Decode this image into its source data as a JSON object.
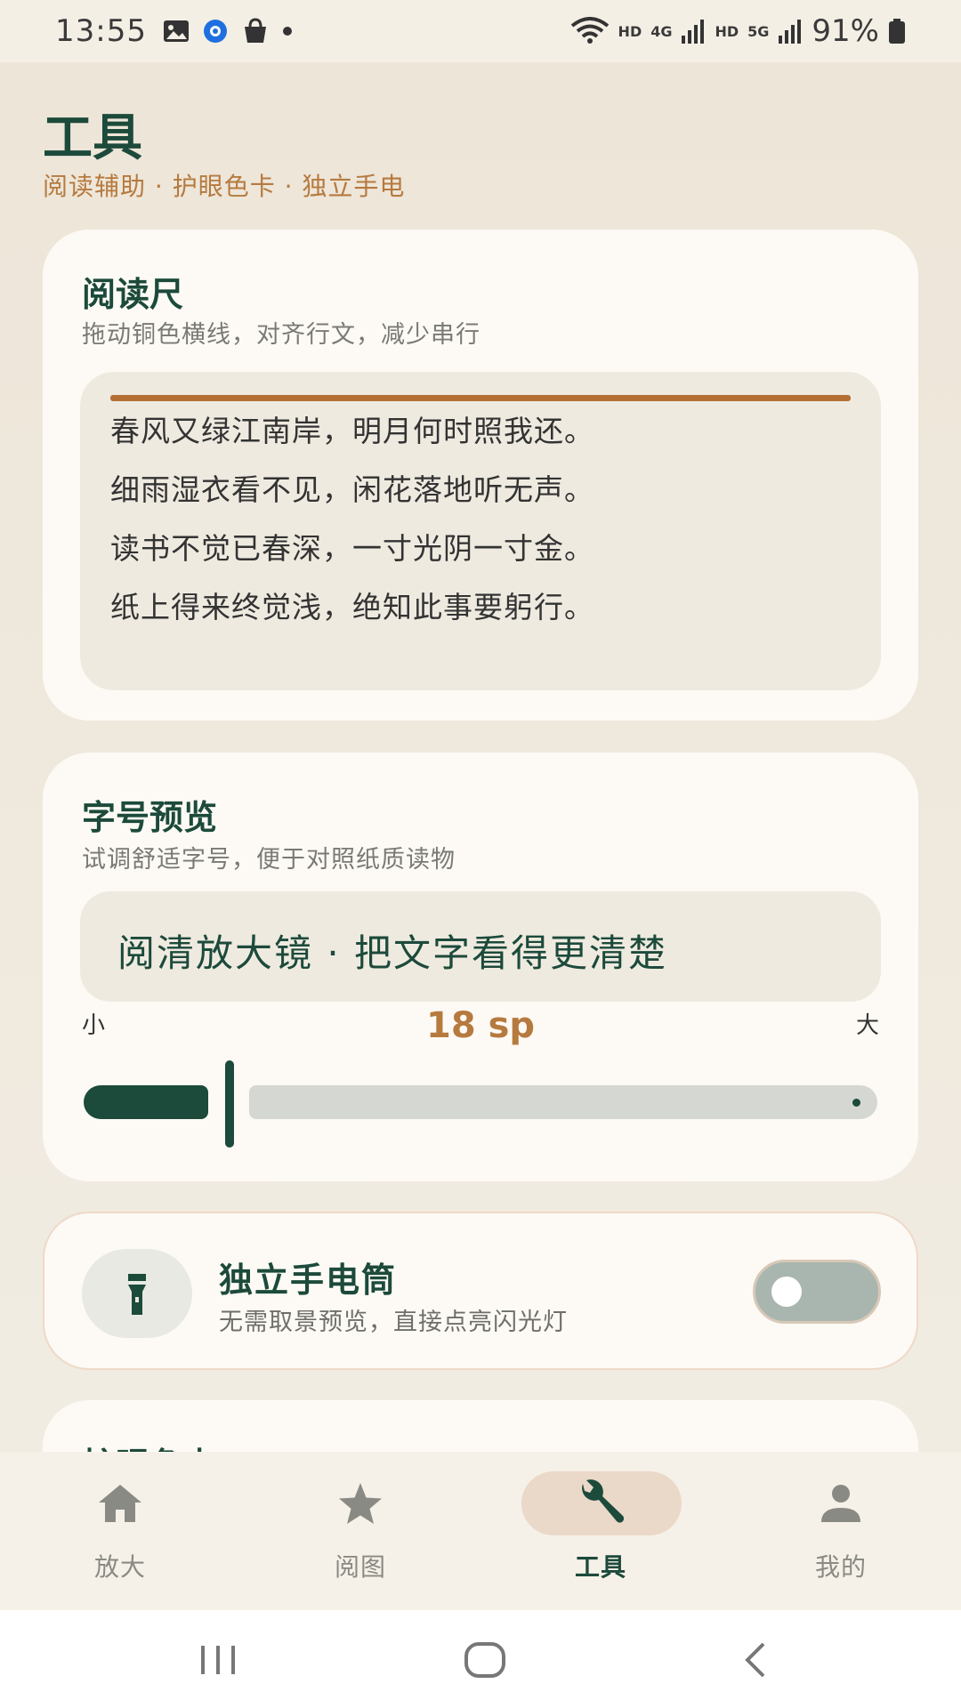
{
  "status_bar": {
    "time": "13:55",
    "hd1": "HD",
    "net1": "4G",
    "hd2": "HD",
    "net2": "5G",
    "battery": "91%"
  },
  "header": {
    "title": "工具",
    "subtitle": "阅读辅助 · 护眼色卡 · 独立手电"
  },
  "reading_ruler": {
    "title": "阅读尺",
    "desc": "拖动铜色横线，对齐行文，减少串行",
    "lines": [
      "春风又绿江南岸，明月何时照我还。",
      "细雨湿衣看不见，闲花落地听无声。",
      "读书不觉已春深，一寸光阴一寸金。",
      "纸上得来终觉浅，绝知此事要躬行。"
    ]
  },
  "font_preview": {
    "title": "字号预览",
    "desc": "试调舒适字号，便于对照纸质读物",
    "sample": "阅清放大镜 · 把文字看得更清楚",
    "label_small": "小",
    "label_large": "大",
    "size_value": "18 sp"
  },
  "flashlight": {
    "title": "独立手电筒",
    "desc": "无需取景预览，直接点亮闪光灯",
    "enabled": false
  },
  "next_card": {
    "title": "护眼色卡"
  },
  "bottom_nav": {
    "items": [
      {
        "label": "放大",
        "icon": "home-icon"
      },
      {
        "label": "阅图",
        "icon": "star-icon"
      },
      {
        "label": "工具",
        "icon": "wrench-icon"
      },
      {
        "label": "我的",
        "icon": "person-icon"
      }
    ],
    "active_index": 2
  },
  "colors": {
    "primary": "#1c4a3b",
    "accent": "#b67a3f",
    "background": "#f1ebe0",
    "card": "#fdfaf5"
  }
}
